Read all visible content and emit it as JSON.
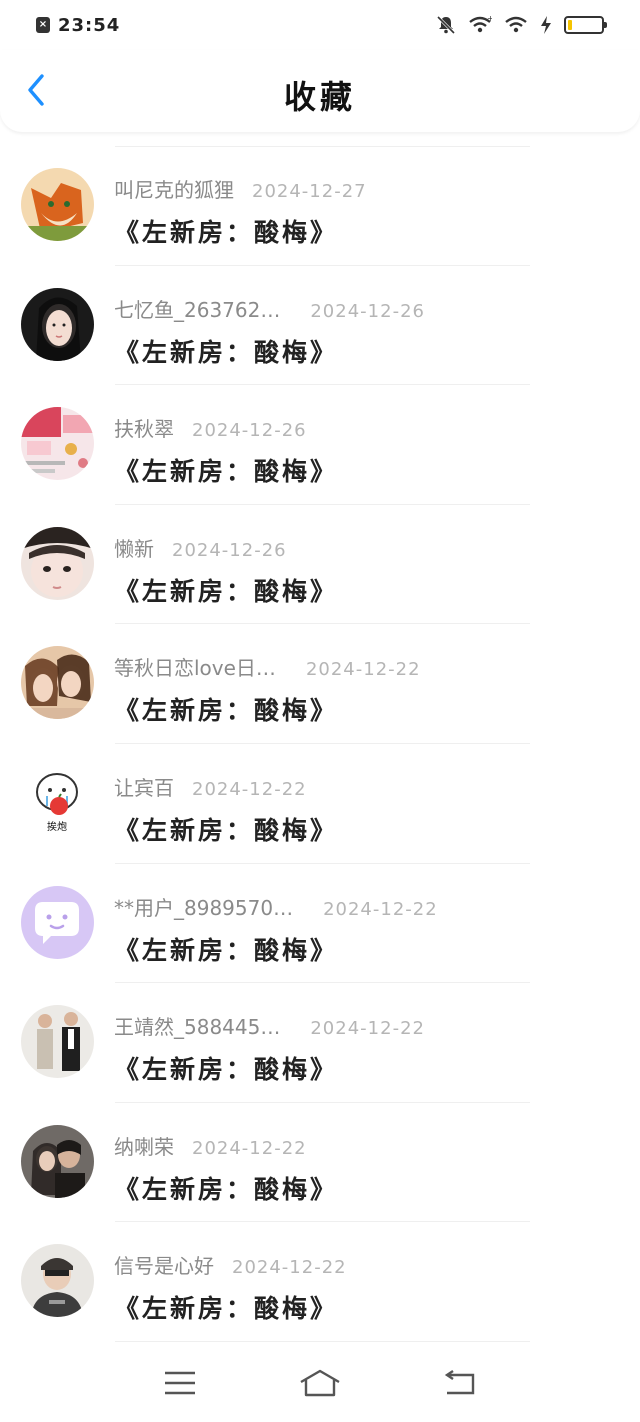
{
  "status_bar": {
    "time": "23:54",
    "notification_icon": "x-square-icon",
    "icons": [
      "mute-bell-icon",
      "wifi-icon",
      "wifi-icon",
      "charging-bolt-icon",
      "battery-icon"
    ],
    "battery_level": 0.12,
    "battery_color": "#f5c400"
  },
  "header": {
    "title": "收藏",
    "back_icon": "chevron-left-icon",
    "accent_color": "#1e90ff"
  },
  "favorites": [
    {
      "username": "叫尼克的狐狸",
      "date": "2024-12-27",
      "book": "《左新房：酸梅》"
    },
    {
      "username": "七忆鱼_263762…",
      "date": "2024-12-26",
      "book": "《左新房：酸梅》"
    },
    {
      "username": "扶秋翠",
      "date": "2024-12-26",
      "book": "《左新房：酸梅》"
    },
    {
      "username": "懒新",
      "date": "2024-12-26",
      "book": "《左新房：酸梅》"
    },
    {
      "username": "等秋日恋love日…",
      "date": "2024-12-22",
      "book": "《左新房：酸梅》"
    },
    {
      "username": "让宾百",
      "date": "2024-12-22",
      "book": "《左新房：酸梅》"
    },
    {
      "username": "**用户_8989570…",
      "date": "2024-12-22",
      "book": "《左新房：酸梅》"
    },
    {
      "username": "王靖然_588445…",
      "date": "2024-12-22",
      "book": "《左新房：酸梅》"
    },
    {
      "username": "纳喇荣",
      "date": "2024-12-22",
      "book": "《左新房：酸梅》"
    },
    {
      "username": "信号是心好",
      "date": "2024-12-22",
      "book": "《左新房：酸梅》"
    }
  ],
  "avatar_stickers": {
    "item6": "挨炮"
  },
  "nav_bar": {
    "icons": [
      "menu-icon",
      "home-icon",
      "back-icon"
    ]
  }
}
